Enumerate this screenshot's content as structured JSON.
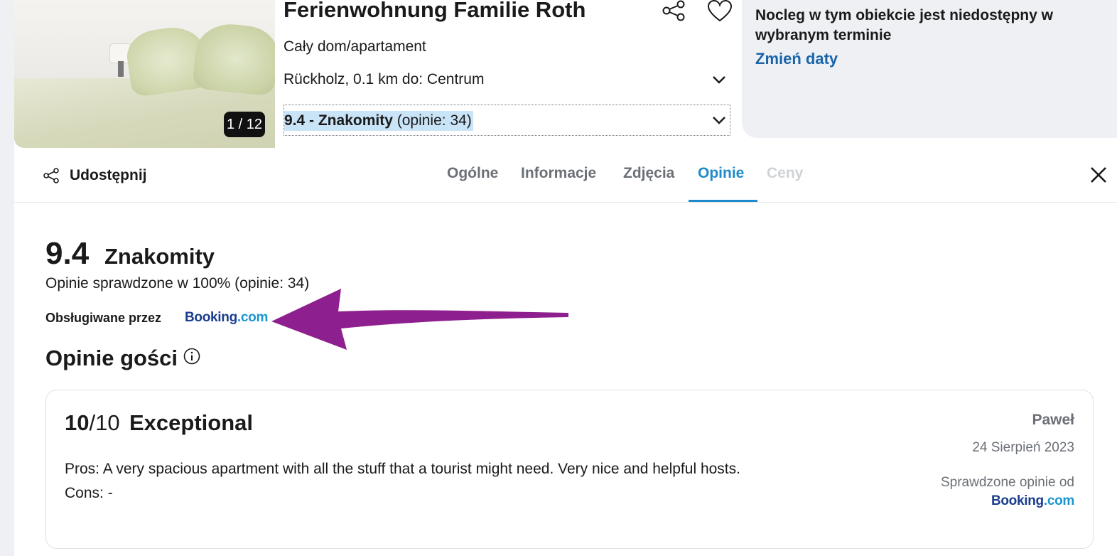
{
  "header": {
    "title": "Ferienwohnung Familie Roth",
    "type": "Cały dom/apartament",
    "location": "Rückholz, 0.1 km do: Centrum",
    "rating_bold": "9.4 - Znakomity",
    "rating_count": "(opinie: 34)",
    "photo_counter": "1 / 12"
  },
  "availability": {
    "message": "Nocleg w tym obiekcie jest niedostępny w wybranym terminie",
    "link": "Zmień daty"
  },
  "tabbar": {
    "share": "Udostępnij",
    "tabs": [
      {
        "label": "Ogólne",
        "state": "normal"
      },
      {
        "label": "Informacje",
        "state": "normal"
      },
      {
        "label": "Zdjęcia",
        "state": "normal"
      },
      {
        "label": "Opinie",
        "state": "active"
      },
      {
        "label": "Ceny",
        "state": "disabled"
      }
    ]
  },
  "reviews": {
    "score": "9.4",
    "score_word": "Znakomity",
    "verified": "Opinie sprawdzone w 100% (opinie: 34)",
    "powered_by": "Obsługiwane przez",
    "provider_part1": "Booking",
    "provider_part2": ".com",
    "guest_heading": "Opinie gości",
    "items": [
      {
        "score": "10",
        "score_max": "/10",
        "title": "Exceptional",
        "text": "Pros: A very spacious apartment with all the stuff that a tourist might need. Very nice and helpful hosts. Cons: -",
        "author": "Paweł",
        "date": "24 Sierpień 2023",
        "verified_label": "Sprawdzone opinie od"
      }
    ]
  },
  "colors": {
    "accent": "#1f8ac9",
    "link": "#1a64a8",
    "arrow": "#8e1f8e",
    "booking_dark": "#1a3d8f",
    "booking_light": "#1a95d3"
  }
}
